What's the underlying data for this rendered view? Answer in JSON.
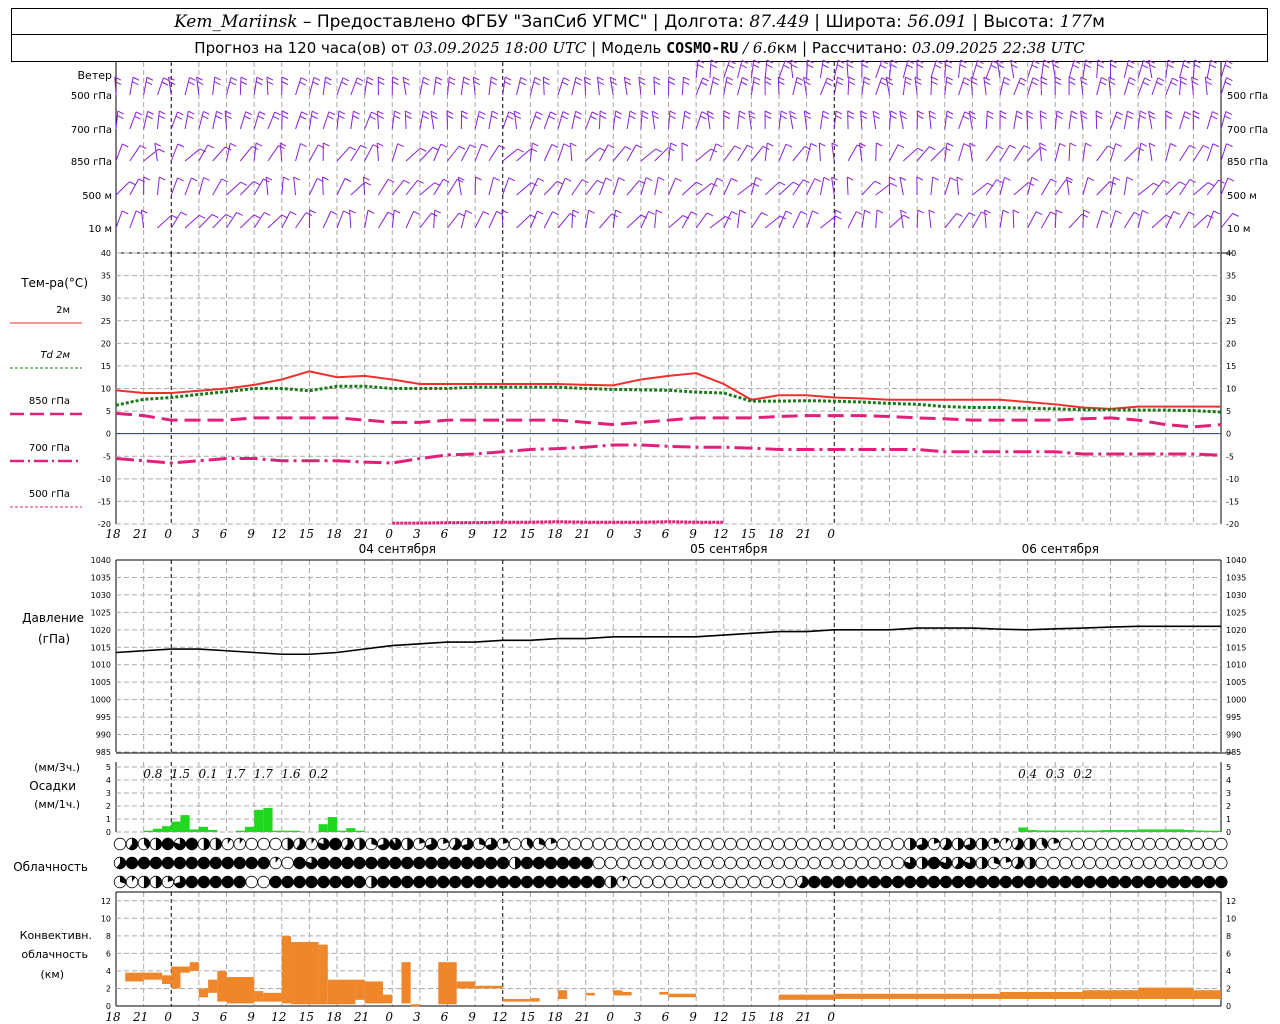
{
  "header": {
    "station": "Kem_Mariinsk",
    "dash": "–",
    "provider": "Предоставлено ФГБУ \"ЗапСиб УГМС\"",
    "lon_label": "Долгота:",
    "lon_value": "87.449",
    "lat_label": "Широта:",
    "lat_value": "56.091",
    "alt_label": "Высота:",
    "alt_value": "177",
    "alt_unit": "м",
    "forecast_label": "Прогноз на 120 часа(ов) от",
    "forecast_start": "03.09.2025 18:00 UTC",
    "model_label": "Модель",
    "model_name": "COSMO-RU",
    "model_res": "/ 6.6",
    "model_res_unit": "км",
    "calc_label": "Рассчитано:",
    "calc_time": "03.09.2025 22:38 UTC",
    "sep": "|"
  },
  "colors": {
    "wind": "#8b1fd8",
    "t2m": "#f0302c",
    "td2m": "#1a7a1a",
    "t850": "#e0207a",
    "t700": "#e0207a",
    "t500": "#e0207a",
    "pressure": "#000000",
    "precip": "#20d820",
    "convective": "#f0862a",
    "zero_line": "#2020ff"
  },
  "x_axis": {
    "tick_labels": [
      "18",
      "21",
      "0",
      "3",
      "6",
      "9",
      "12",
      "15",
      "18",
      "21",
      "0",
      "3",
      "6",
      "9",
      "12",
      "15",
      "18",
      "21",
      "0",
      "3",
      "6",
      "9",
      "12",
      "15",
      "18",
      "21",
      "0"
    ],
    "day_labels": [
      "04 сентября",
      "05 сентября",
      "06 сентября"
    ]
  },
  "wind_panel": {
    "title": "Ветер",
    "levels": [
      "500 гПа",
      "700 гПа",
      "850 гПа",
      "500 м",
      "10  м"
    ],
    "right_levels": [
      "500 гПа",
      "700 гПа",
      "850 гПа",
      "500 м",
      "10  м"
    ]
  },
  "temp_panel": {
    "title": "Тем-ра(°C)",
    "legend": [
      {
        "label": "2м",
        "style": "solid",
        "color": "#f0302c"
      },
      {
        "label": "Td  2м",
        "style": "dotted",
        "color": "#1a7a1a"
      },
      {
        "label": "850 гПа",
        "style": "dash",
        "color": "#e0207a"
      },
      {
        "label": "700 гПа",
        "style": "dashdot",
        "color": "#e0207a"
      },
      {
        "label": "500 гПа",
        "style": "dash",
        "color": "#e0207a"
      }
    ],
    "ticks": [
      "40",
      "35",
      "30",
      "25",
      "20",
      "15",
      "10",
      "5",
      "0",
      "-5",
      "-10",
      "-15",
      "-20"
    ]
  },
  "pressure_panel": {
    "title": "Давление",
    "unit": "(гПа)",
    "ticks": [
      "1040",
      "1035",
      "1030",
      "1025",
      "1020",
      "1015",
      "1010",
      "1005",
      "1000",
      "995",
      "990",
      "985"
    ]
  },
  "precip_panel": {
    "title_top": "(мм/3ч.)",
    "title": "Осадки",
    "title_bottom": "(мм/1ч.)",
    "ticks": [
      "5",
      "4",
      "3",
      "2",
      "1",
      "0"
    ],
    "totals": [
      {
        "hour": -18,
        "text": "0.8"
      },
      {
        "hour": -15,
        "text": "1.5"
      },
      {
        "hour": -12,
        "text": "0.1"
      },
      {
        "hour": -9,
        "text": "1.7"
      },
      {
        "hour": -6,
        "text": "1.7"
      },
      {
        "hour": -3,
        "text": "1.6"
      },
      {
        "hour": 0,
        "text": "0.2"
      },
      {
        "hour": 99,
        "text": "0.4"
      },
      {
        "hour": 102,
        "text": "0.3"
      },
      {
        "hour": 105,
        "text": "0.2"
      }
    ]
  },
  "cloud_panel": {
    "title": "Облачность"
  },
  "conv_panel": {
    "title1": "Конвективн.",
    "title2": "облачность",
    "title3": "(км)",
    "ticks": [
      "12",
      "10",
      "8",
      "6",
      "4",
      "2",
      "0"
    ]
  },
  "chart_data": [
    {
      "type": "line",
      "title": "Тем-ра(°C)",
      "x_unit": "hours from 03.09.2025 18:00 UTC",
      "ylim": [
        -20,
        40
      ],
      "series": [
        {
          "name": "2м",
          "x": [
            0,
            3,
            6,
            9,
            12,
            15,
            18,
            21,
            24,
            27,
            30,
            33,
            36,
            39,
            42,
            45,
            48,
            51,
            54,
            57,
            60,
            63,
            66,
            69,
            72,
            75,
            78,
            81,
            84,
            87,
            90,
            93,
            96,
            99,
            102,
            105,
            108,
            111,
            114,
            117,
            120
          ],
          "values": [
            9.6,
            9,
            9,
            9.5,
            10,
            10.8,
            12,
            13.8,
            12.5,
            12.8,
            12,
            11,
            11,
            11,
            11,
            11,
            11,
            10.8,
            10.7,
            12,
            12.8,
            13.4,
            11,
            7.5,
            8.5,
            8.5,
            8,
            7.8,
            7.5,
            7.5,
            7.5,
            7.5,
            7.5,
            7,
            6.5,
            5.8,
            5.5,
            6,
            6,
            6,
            6
          ]
        },
        {
          "name": "Td  2м",
          "x": [
            0,
            3,
            6,
            9,
            12,
            15,
            18,
            21,
            24,
            27,
            30,
            33,
            36,
            39,
            42,
            45,
            48,
            51,
            54,
            57,
            60,
            63,
            66,
            69,
            72,
            75,
            78,
            81,
            84,
            87,
            90,
            93,
            96,
            99,
            102,
            105,
            108,
            111,
            114,
            117,
            120
          ],
          "values": [
            6.3,
            7.6,
            8,
            8.7,
            9.3,
            10,
            10,
            9.5,
            10.5,
            10.5,
            10,
            10,
            10,
            10.3,
            10.3,
            10.3,
            10.3,
            10,
            9.8,
            9.7,
            9.6,
            9.2,
            9,
            7.2,
            7.2,
            7.3,
            7.2,
            7,
            6.7,
            6.5,
            6,
            5.8,
            5.8,
            5.6,
            5.5,
            5.3,
            5.3,
            5.2,
            5.2,
            5.1,
            4.8
          ]
        },
        {
          "name": "850 гПа",
          "x": [
            0,
            3,
            6,
            9,
            12,
            15,
            18,
            21,
            24,
            27,
            30,
            33,
            36,
            39,
            42,
            45,
            48,
            51,
            54,
            57,
            60,
            63,
            66,
            69,
            72,
            75,
            78,
            81,
            84,
            87,
            90,
            93,
            96,
            99,
            102,
            105,
            108,
            111,
            114,
            117,
            120
          ],
          "values": [
            4.5,
            4,
            3,
            3,
            3,
            3.5,
            3.5,
            3.5,
            3.5,
            3,
            2.5,
            2.5,
            3,
            3,
            3,
            3,
            3,
            2.5,
            2,
            2.5,
            3,
            3.5,
            3.5,
            3.5,
            3.8,
            4,
            4,
            4,
            3.8,
            3.5,
            3.3,
            3,
            3,
            3,
            3,
            3.3,
            3.5,
            3,
            2,
            1.5,
            2
          ]
        },
        {
          "name": "700 гПа",
          "x": [
            0,
            3,
            6,
            9,
            12,
            15,
            18,
            21,
            24,
            27,
            30,
            33,
            36,
            39,
            42,
            45,
            48,
            51,
            54,
            57,
            60,
            63,
            66,
            69,
            72,
            75,
            78,
            81,
            84,
            87,
            90,
            93,
            96,
            99,
            102,
            105,
            108,
            111,
            114,
            117,
            120
          ],
          "values": [
            -5.5,
            -6,
            -6.5,
            -6,
            -5.5,
            -5.5,
            -6,
            -6,
            -6,
            -6.3,
            -6.5,
            -5.5,
            -4.7,
            -4.5,
            -4,
            -3.5,
            -3.3,
            -3,
            -2.5,
            -2.5,
            -2.8,
            -3,
            -3,
            -3.2,
            -3.5,
            -3.5,
            -3.5,
            -3.5,
            -3.5,
            -3.5,
            -4,
            -4,
            -4,
            -4,
            -4,
            -4.5,
            -4.5,
            -4.5,
            -4.5,
            -4.5,
            -4.8
          ]
        },
        {
          "name": "500 гПа",
          "x": [
            30,
            33,
            36,
            39,
            42,
            45,
            48,
            51,
            54,
            57,
            60,
            63,
            66
          ],
          "values": [
            -19.8,
            -19.8,
            -19.7,
            -19.7,
            -19.6,
            -19.6,
            -19.5,
            -19.6,
            -19.6,
            -19.6,
            -19.5,
            -19.6,
            -19.6
          ]
        }
      ]
    },
    {
      "type": "line",
      "title": "Давление",
      "ylabel": "(гПа)",
      "ylim": [
        985,
        1040
      ],
      "series": [
        {
          "name": "Давление",
          "x": [
            0,
            3,
            6,
            9,
            12,
            15,
            18,
            21,
            24,
            27,
            30,
            33,
            36,
            39,
            42,
            45,
            48,
            51,
            54,
            57,
            60,
            63,
            66,
            69,
            72,
            75,
            78,
            81,
            84,
            87,
            90,
            93,
            96,
            99,
            102,
            105,
            108,
            111,
            114,
            117,
            120
          ],
          "values": [
            1013.5,
            1014,
            1014.5,
            1014.5,
            1014,
            1013.5,
            1013,
            1013,
            1013.5,
            1014.5,
            1015.5,
            1016,
            1016.5,
            1016.5,
            1017,
            1017,
            1017.5,
            1017.5,
            1018,
            1018,
            1018,
            1018,
            1018.5,
            1019,
            1019.5,
            1019.5,
            1020,
            1020,
            1020,
            1020.5,
            1020.5,
            1020.5,
            1020.2,
            1020,
            1020.3,
            1020.5,
            1020.8,
            1021,
            1021,
            1021,
            1021
          ]
        }
      ]
    },
    {
      "type": "bar",
      "title": "Осадки",
      "ylabel": "мм/1ч.",
      "ylim": [
        0,
        5
      ],
      "x": [
        4,
        5,
        6,
        7,
        8,
        9,
        10,
        11,
        14,
        15,
        16,
        17,
        18,
        19,
        20,
        23,
        24,
        25,
        26,
        27,
        99,
        100,
        101,
        102,
        103,
        104,
        105,
        106,
        107,
        108,
        109,
        110,
        111,
        112,
        113,
        114,
        115,
        116,
        117,
        118,
        119,
        120
      ],
      "values": [
        0.1,
        0.25,
        0.45,
        0.8,
        1.3,
        0.2,
        0.4,
        0.15,
        0.1,
        0.4,
        1.7,
        1.85,
        0.1,
        0.1,
        0.1,
        0.6,
        1.15,
        0.1,
        0.3,
        0.1,
        0.35,
        0.15,
        0.12,
        0.12,
        0.12,
        0.12,
        0.12,
        0.12,
        0.12,
        0.15,
        0.15,
        0.15,
        0.15,
        0.2,
        0.2,
        0.2,
        0.2,
        0.2,
        0.15,
        0.12,
        0.1,
        0.1
      ]
    },
    {
      "type": "bar",
      "title": "Конвективн. облачность",
      "ylabel": "км",
      "ylim": [
        0,
        13
      ],
      "bars": [
        {
          "x0": 1,
          "x1": 3,
          "bottom": 2.8,
          "top": 3.8
        },
        {
          "x0": 3,
          "x1": 5,
          "bottom": 3,
          "top": 3.8
        },
        {
          "x0": 5,
          "x1": 6,
          "bottom": 2.5,
          "top": 3.5
        },
        {
          "x0": 6,
          "x1": 7,
          "bottom": 2,
          "top": 4.5
        },
        {
          "x0": 7,
          "x1": 8,
          "bottom": 3.8,
          "top": 4.5
        },
        {
          "x0": 8,
          "x1": 9,
          "bottom": 4,
          "top": 5
        },
        {
          "x0": 9,
          "x1": 10,
          "bottom": 1,
          "top": 2
        },
        {
          "x0": 10,
          "x1": 11,
          "bottom": 1.5,
          "top": 3
        },
        {
          "x0": 11,
          "x1": 12,
          "bottom": 0.5,
          "top": 4
        },
        {
          "x0": 12,
          "x1": 15,
          "bottom": 0.3,
          "top": 3.3
        },
        {
          "x0": 15,
          "x1": 16,
          "bottom": 0.5,
          "top": 1.7
        },
        {
          "x0": 16,
          "x1": 18,
          "bottom": 0.5,
          "top": 1.5
        },
        {
          "x0": 18,
          "x1": 19,
          "bottom": 0.3,
          "top": 8
        },
        {
          "x0": 19,
          "x1": 22,
          "bottom": 0.2,
          "top": 7.3
        },
        {
          "x0": 22,
          "x1": 23,
          "bottom": 0.2,
          "top": 7
        },
        {
          "x0": 23,
          "x1": 26,
          "bottom": 0.2,
          "top": 3
        },
        {
          "x0": 26,
          "x1": 27,
          "bottom": 0.7,
          "top": 3
        },
        {
          "x0": 27,
          "x1": 29,
          "bottom": 0.3,
          "top": 2.8
        },
        {
          "x0": 29,
          "x1": 30,
          "bottom": 0.3,
          "top": 1.3
        },
        {
          "x0": 31,
          "x1": 32,
          "bottom": 0.3,
          "top": 5
        },
        {
          "x0": 32,
          "x1": 33,
          "bottom": 0.2,
          "top": 0.2
        },
        {
          "x0": 35,
          "x1": 37,
          "bottom": 0.2,
          "top": 5
        },
        {
          "x0": 37,
          "x1": 39,
          "bottom": 2,
          "top": 2.8
        },
        {
          "x0": 39,
          "x1": 42,
          "bottom": 2,
          "top": 2.3
        },
        {
          "x0": 42,
          "x1": 45,
          "bottom": 0.5,
          "top": 0.8
        },
        {
          "x0": 45,
          "x1": 46,
          "bottom": 0.5,
          "top": 0.9
        },
        {
          "x0": 48,
          "x1": 49,
          "bottom": 0.8,
          "top": 1.8
        },
        {
          "x0": 51,
          "x1": 52,
          "bottom": 1.2,
          "top": 1.5
        },
        {
          "x0": 54,
          "x1": 55,
          "bottom": 1.2,
          "top": 1.8
        },
        {
          "x0": 55,
          "x1": 56,
          "bottom": 1.2,
          "top": 1.6
        },
        {
          "x0": 59,
          "x1": 60,
          "bottom": 1.3,
          "top": 1.6
        },
        {
          "x0": 60,
          "x1": 63,
          "bottom": 1,
          "top": 1.4
        },
        {
          "x0": 72,
          "x1": 78,
          "bottom": 0.7,
          "top": 1.3
        },
        {
          "x0": 78,
          "x1": 96,
          "bottom": 0.8,
          "top": 1.4
        },
        {
          "x0": 96,
          "x1": 105,
          "bottom": 0.8,
          "top": 1.6
        },
        {
          "x0": 105,
          "x1": 111,
          "bottom": 0.8,
          "top": 1.8
        },
        {
          "x0": 111,
          "x1": 117,
          "bottom": 0.8,
          "top": 2.1
        },
        {
          "x0": 117,
          "x1": 120,
          "bottom": 0.8,
          "top": 1.8
        }
      ]
    },
    {
      "type": "table",
      "title": "Облачность",
      "rows": [
        "0,0.6,0.4,0.5,1,0.8,1,0.5,0.5,0.1,0.1,0,0,0,0.5,0.6,0.1,0.8,1,0.6,0.5,0.3,0.7,0.9,0.5,0.2,0.7,0.2,0.6,0.7,0.3,0.7,0.2,0,0.4,0.3,0.2,0,0,0,0,0,0,0,0,0,0,0,0,0,0,0,0,0,0,0,0,0,0,0,0,0,0,0,0,0,0.5,0.7,0.2,0.6,0.5,0.7,0.5,0.2,0.1,0.6,0.5,0.4,0.2,0,0,0,0,0,0,0,0,0,0,0,0,0,0,0,0,0,0",
        "0.6,1,1,1,1,1,1,1,1,1,1,1,1,0.1,0,1,0.8,1,1,1,1,1,1,1,1,1,1,1,1,1,1,1,1,0.5,1,1,1,1,1,1,0,0,0,0,0,0,0,0,0,0,0,0,0,0,0,0,0,0,0,0,0,0,0,0,0,0,0.8,0.5,1,0.8,0.6,0.8,0.5,0.3,0.2,0.6,0.5,0,0,0,0,0,0,0,0,0,0,0,0,0,0,0,0,0,0,0,0",
        "0.3,0.1,0.5,0.5,0.2,0.7,1,1,1,1,1,0,0,1,1,1,1,1,1,1,1,0.5,1,1,1,1,1,1,1,1,1,1,1,1,1,1,1,1,1,1,1,0.5,0.1,0,0,0,0,0,0,0,0,0,0,0,0,0,0,0.6,1,1,1,1,1,1,1,1,1,1,1,1,1,1,1,1,1,1,1,1,1,1,1,1,1,1,1,1,1,1,1,1,1,1,1,1,1,1"
      ]
    }
  ]
}
